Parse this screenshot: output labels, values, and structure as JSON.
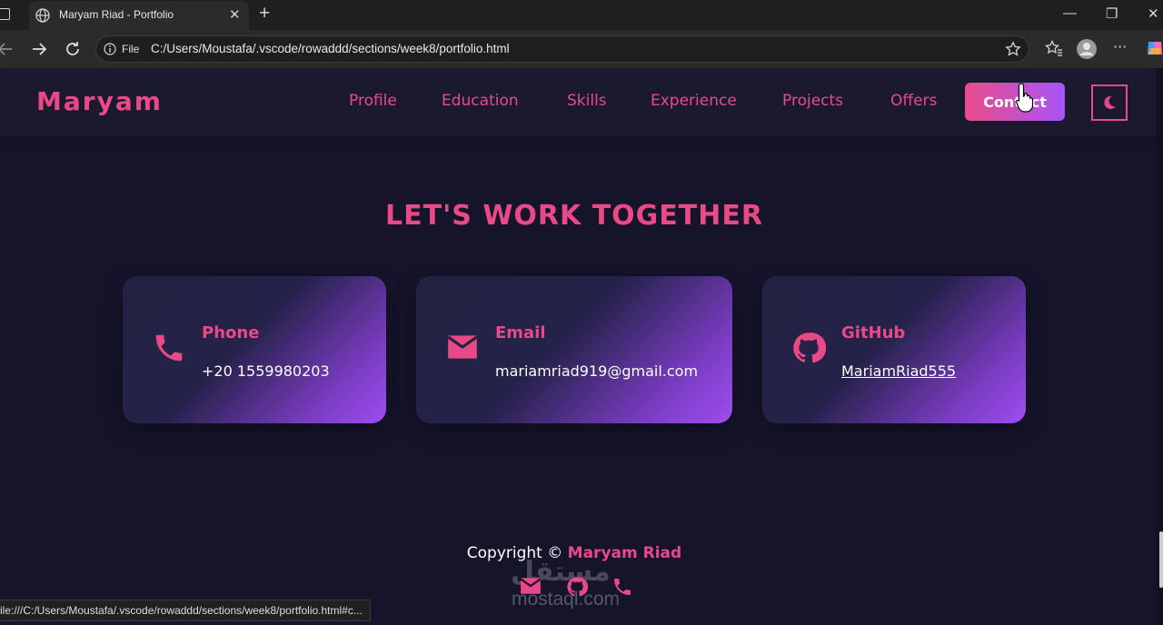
{
  "browser": {
    "tab_title": "Maryam Riad - Portfolio",
    "address_scheme_label": "File",
    "address_url": "C:/Users/Moustafa/.vscode/rowaddd/sections/week8/portfolio.html",
    "status_url": "ile:///C:/Users/Moustafa/.vscode/rowaddd/sections/week8/portfolio.html#c..."
  },
  "header": {
    "logo": "Maryam",
    "nav": [
      "Profile",
      "Education",
      "Skills",
      "Experience",
      "Projects",
      "Offers"
    ],
    "contact_label": "Contact"
  },
  "contact": {
    "title": "LET'S WORK TOGETHER",
    "cards": [
      {
        "label": "Phone",
        "value": "+20 1559980203",
        "icon": "phone-icon"
      },
      {
        "label": "Email",
        "value": "mariamriad919@gmail.com",
        "icon": "envelope-icon"
      },
      {
        "label": "GitHub",
        "value": "MariamRiad555",
        "icon": "github-icon"
      }
    ]
  },
  "footer": {
    "copyright_prefix": "Copyright ©",
    "copyright_name": "Maryam Riad",
    "icons": [
      "envelope-icon",
      "github-icon",
      "phone-icon"
    ]
  },
  "watermark": {
    "text": "مستقل",
    "sub": "mostaql.com"
  },
  "colors": {
    "accent": "#e94a87",
    "purple": "#a855f7",
    "background": "#16142b"
  }
}
